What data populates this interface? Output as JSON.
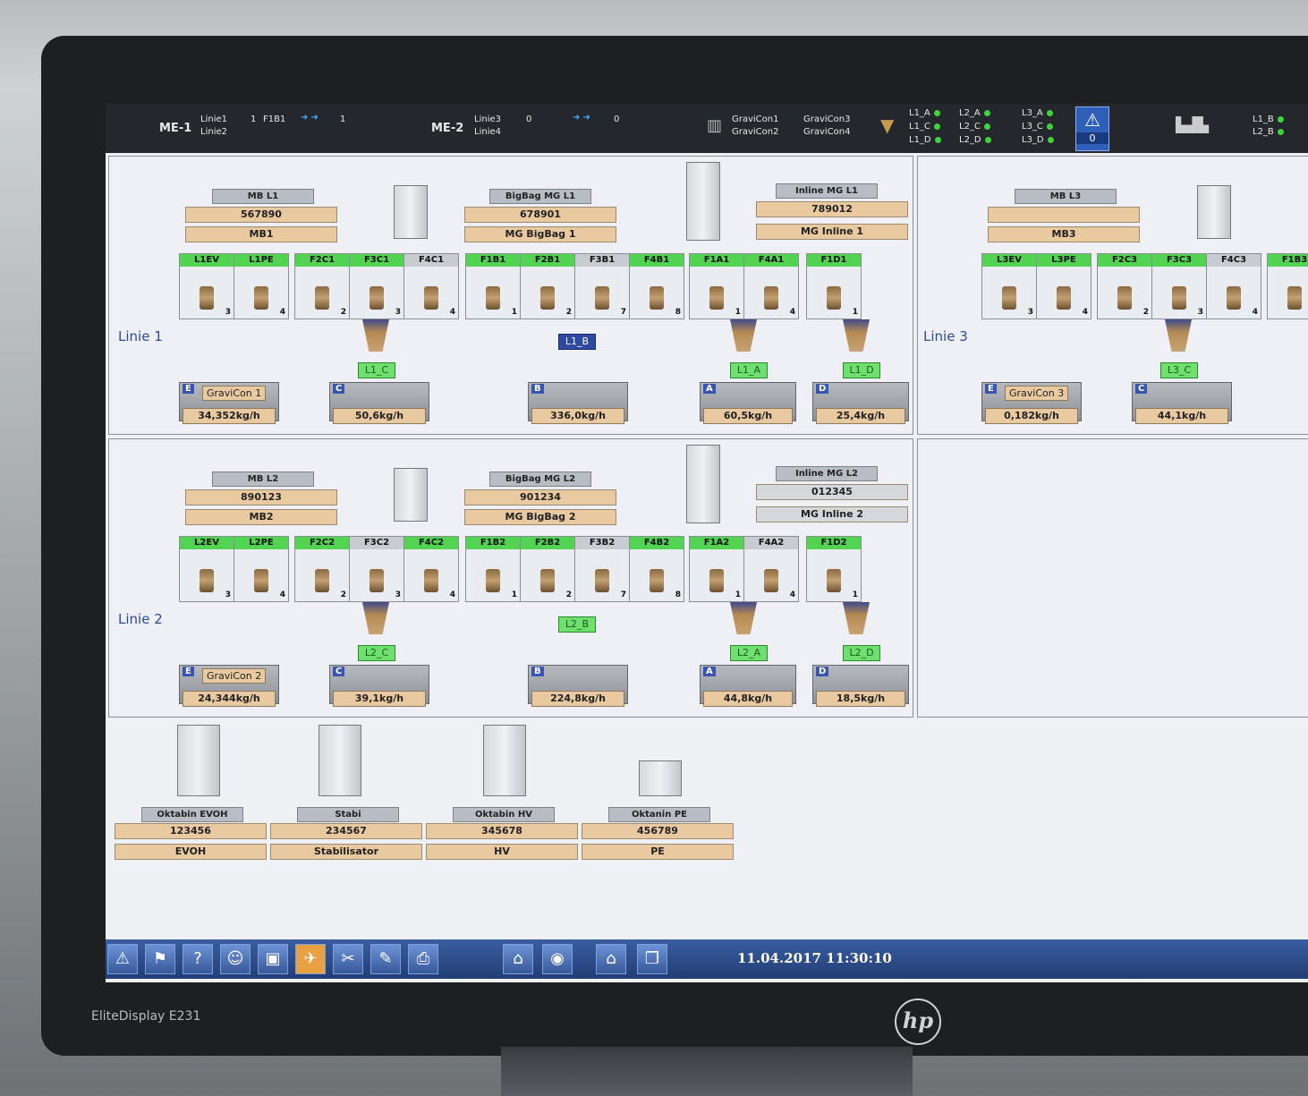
{
  "topbar": {
    "me1": "ME-1",
    "me1_l1": "Linie1",
    "me1_l2": "Linie2",
    "me1_n1": "1",
    "me1_f": "F1B1",
    "me1_n2": "1",
    "me2": "ME-2",
    "me2_l1": "Linie3",
    "me2_l2": "Linie4",
    "me2_n1": "0",
    "me2_n2": "0",
    "gc1": "GraviCon1",
    "gc2": "GraviCon2",
    "gc3": "GraviCon3",
    "gc4": "GraviCon4",
    "st": [
      [
        "L1_A",
        "L2_A",
        "L3_A"
      ],
      [
        "L1_C",
        "L2_C",
        "L3_C"
      ],
      [
        "L1_D",
        "L2_D",
        "L3_D"
      ]
    ],
    "alarm_count": "0",
    "right1": "L1_B",
    "right2": "L2_B"
  },
  "linie1": {
    "label": "Linie 1",
    "mb_hdr": "MB L1",
    "mb_val": "567890",
    "mb_name": "MB1",
    "bb_hdr": "BigBag MG L1",
    "bb_val": "678901",
    "bb_name": "MG BigBag 1",
    "in_hdr": "Inline MG L1",
    "in_val": "789012",
    "in_name": "MG Inline 1",
    "tanks": [
      [
        "L1EV",
        "3"
      ],
      [
        "L1PE",
        "4"
      ],
      [
        "F2C1",
        "2"
      ],
      [
        "F3C1",
        "3"
      ],
      [
        "F4C1",
        "4"
      ],
      [
        "F1B1",
        "1"
      ],
      [
        "F2B1",
        "2"
      ],
      [
        "F3B1",
        "7"
      ],
      [
        "F4B1",
        "8"
      ],
      [
        "F1A1",
        "1"
      ],
      [
        "F4A1",
        "4"
      ],
      [
        "F1D1",
        "1"
      ]
    ],
    "tags": [
      "L1_C",
      "L1_B",
      "L1_A",
      "L1_D"
    ],
    "gravicon": "GraviCon 1",
    "rates": [
      "34,352kg/h",
      "50,6kg/h",
      "336,0kg/h",
      "60,5kg/h",
      "25,4kg/h"
    ]
  },
  "linie2": {
    "label": "Linie 2",
    "mb_hdr": "MB L2",
    "mb_val": "890123",
    "mb_name": "MB2",
    "bb_hdr": "BigBag MG L2",
    "bb_val": "901234",
    "bb_name": "MG BigBag 2",
    "in_hdr": "Inline MG L2",
    "in_val": "012345",
    "in_name": "MG Inline 2",
    "tanks": [
      [
        "L2EV",
        "3"
      ],
      [
        "L2PE",
        "4"
      ],
      [
        "F2C2",
        "2"
      ],
      [
        "F3C2",
        "3"
      ],
      [
        "F4C2",
        "4"
      ],
      [
        "F1B2",
        "1"
      ],
      [
        "F2B2",
        "2"
      ],
      [
        "F3B2",
        "7"
      ],
      [
        "F4B2",
        "8"
      ],
      [
        "F1A2",
        "1"
      ],
      [
        "F4A2",
        "4"
      ],
      [
        "F1D2",
        "1"
      ]
    ],
    "tags": [
      "L2_C",
      "L2_B",
      "L2_A",
      "L2_D"
    ],
    "gravicon": "GraviCon 2",
    "rates": [
      "24,344kg/h",
      "39,1kg/h",
      "224,8kg/h",
      "44,8kg/h",
      "18,5kg/h"
    ]
  },
  "linie3": {
    "label": "Linie 3",
    "mb_hdr": "MB L3",
    "mb_name": "MB3",
    "tanks": [
      [
        "L3EV",
        "3"
      ],
      [
        "L3PE",
        "4"
      ],
      [
        "F2C3",
        "2"
      ],
      [
        "F3C3",
        "3"
      ],
      [
        "F4C3",
        "4"
      ],
      [
        "F1B3",
        ""
      ]
    ],
    "tag": "L3_C",
    "gravicon": "GraviCon 3",
    "rates": [
      "0,182kg/h",
      "44,1kg/h"
    ]
  },
  "oktabins": [
    {
      "hdr": "Oktabin EVOH",
      "val": "123456",
      "name": "EVOH"
    },
    {
      "hdr": "Stabi",
      "val": "234567",
      "name": "Stabilisator"
    },
    {
      "hdr": "Oktabin HV",
      "val": "345678",
      "name": "HV"
    },
    {
      "hdr": "Oktanin PE",
      "val": "456789",
      "name": "PE"
    }
  ],
  "clock": "11.04.2017 11:30:10",
  "monitor_model": "EliteDisplay E231",
  "brand_logo": "hp"
}
